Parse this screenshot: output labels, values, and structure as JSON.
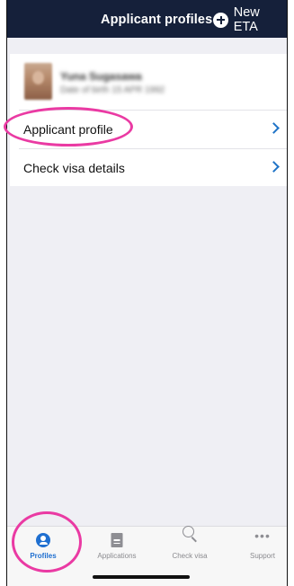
{
  "header": {
    "title": "Applicant profiles",
    "new_eta_label": "New ETA"
  },
  "profile": {
    "name": "Yuna Sugasawa",
    "subtitle": "Date of birth 15 APR 1992"
  },
  "menu": [
    {
      "label": "Applicant profile",
      "highlighted": true
    },
    {
      "label": "Check visa details",
      "highlighted": false
    }
  ],
  "tabs": [
    {
      "label": "Profiles",
      "icon": "profile-icon",
      "active": true
    },
    {
      "label": "Applications",
      "icon": "document-icon",
      "active": false
    },
    {
      "label": "Check visa",
      "icon": "search-icon",
      "active": false
    },
    {
      "label": "Support",
      "icon": "more-icon",
      "active": false
    }
  ],
  "colors": {
    "header_bg": "#15203a",
    "accent": "#1f6fd0",
    "highlight": "#ea3aa3",
    "background": "#efeff4"
  }
}
